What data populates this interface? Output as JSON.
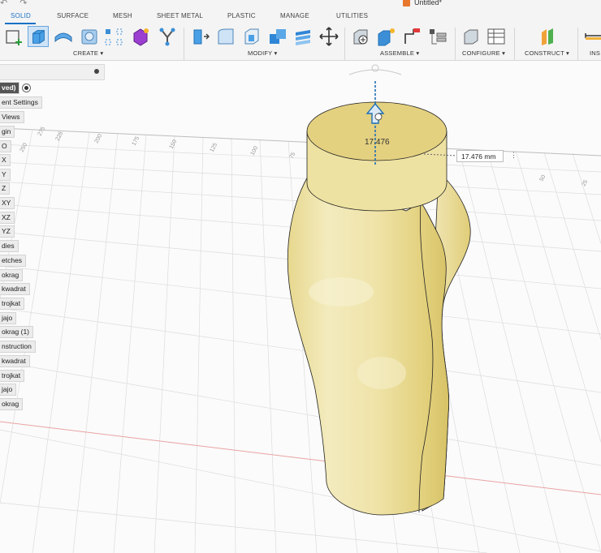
{
  "window": {
    "title": "Untitled*",
    "undo_redo": "↶ ↷"
  },
  "tabs": [
    {
      "label": "SOLID",
      "active": true
    },
    {
      "label": "SURFACE"
    },
    {
      "label": "MESH"
    },
    {
      "label": "SHEET METAL"
    },
    {
      "label": "PLASTIC"
    },
    {
      "label": "MANAGE"
    },
    {
      "label": "UTILITIES"
    }
  ],
  "groups": {
    "create": "CREATE ▾",
    "modify": "MODIFY ▾",
    "assemble": "ASSEMBLE ▾",
    "configure": "CONFIGURE ▾",
    "construct": "CONSTRUCT ▾",
    "inspect": "INS"
  },
  "browser": {
    "root": "ved)",
    "items": [
      "ent Settings",
      "Views",
      "gin",
      "O",
      "X",
      "Y",
      "Z",
      "XY",
      "XZ",
      "YZ",
      "dies",
      "etches",
      "okrag",
      "kwadrat",
      "trojkat",
      "jajo",
      "okrag (1)",
      "nstruction",
      "kwadrat",
      "trojkat",
      "jajo",
      "okrag"
    ]
  },
  "dimension": {
    "label": "17.476",
    "input_value": "17.476 mm",
    "menu": "⋮"
  },
  "ruler_labels": [
    "275",
    "250",
    "225",
    "200",
    "175",
    "150",
    "125",
    "100",
    "75",
    "50",
    "25"
  ],
  "colors": {
    "accent": "#1a72c4",
    "body": "#efe3a8",
    "grid": "#dcdcdc",
    "axis_red": "#e9a3a3"
  }
}
